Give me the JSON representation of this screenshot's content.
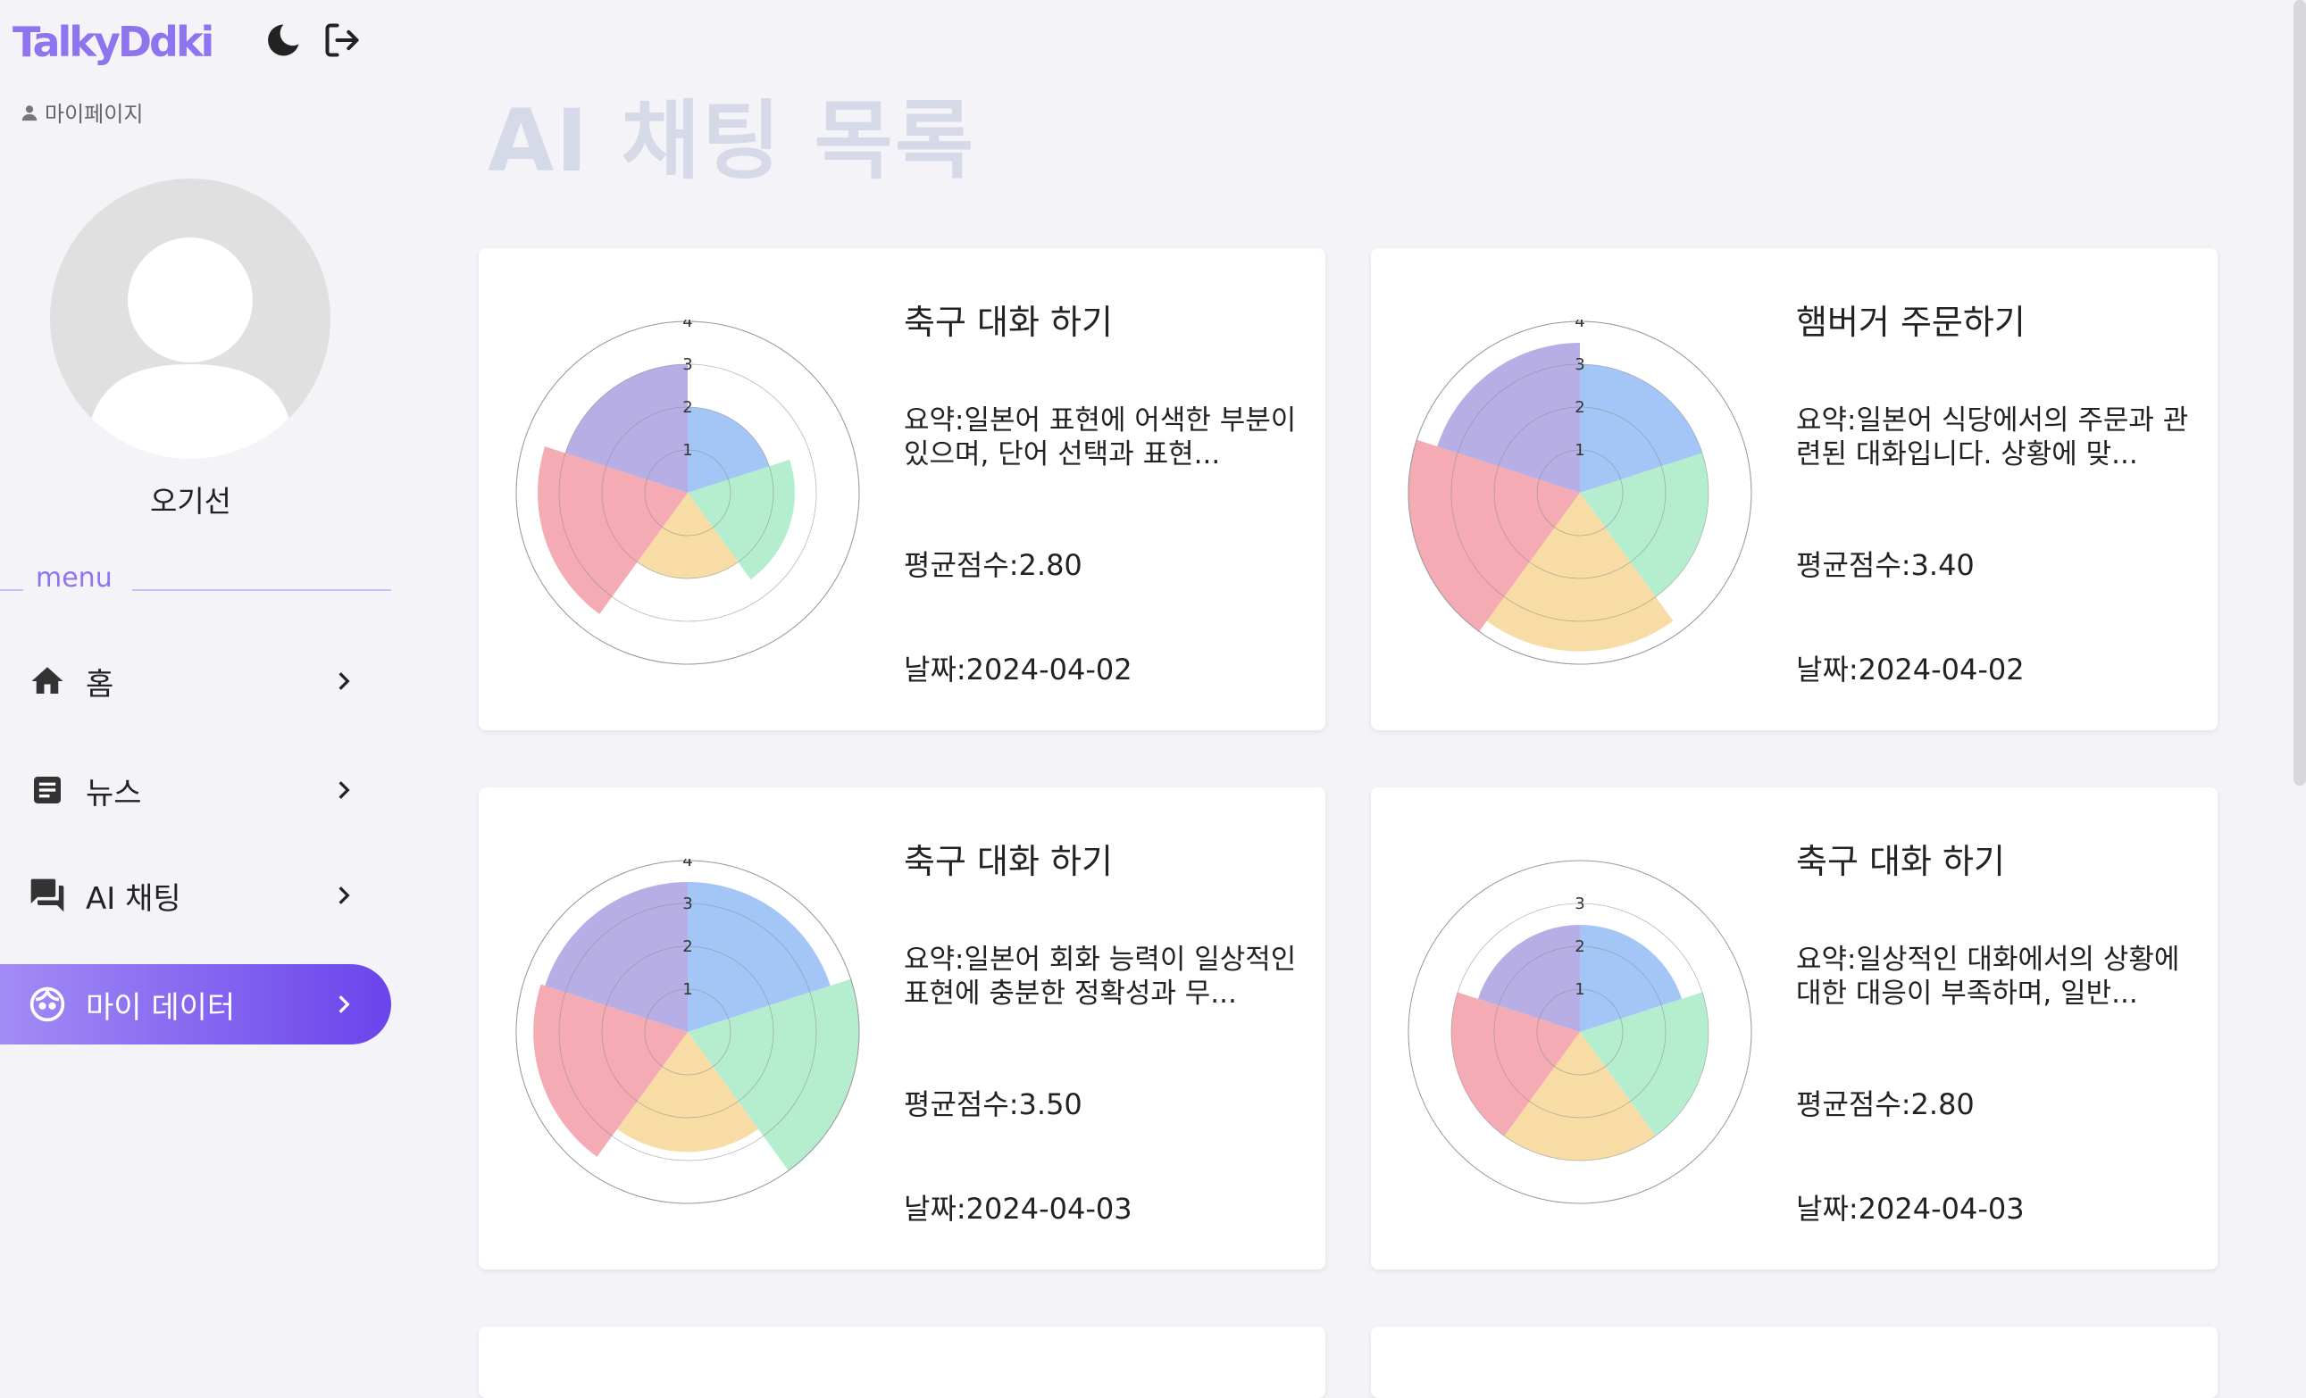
{
  "app": {
    "logo": "TalkyDdki",
    "mypage_link": "마이페이지",
    "username": "오기선",
    "menu_label": "menu",
    "icons": {
      "theme_toggle": "moon-icon",
      "logout": "logout-icon"
    }
  },
  "sidebar": {
    "items": [
      {
        "label": "홈",
        "icon": "home-icon",
        "active": false
      },
      {
        "label": "뉴스",
        "icon": "news-icon",
        "active": false
      },
      {
        "label": "AI 채팅",
        "icon": "chat-icon",
        "active": false
      },
      {
        "label": "마이 데이터",
        "icon": "face-icon",
        "active": true
      }
    ]
  },
  "main": {
    "title": "AI 채팅 목록",
    "cards": [
      {
        "title": "축구 대화 하기",
        "summary": "요약:일본어 표현에 어색한 부분이 있으며, 단어 선택과 표현...",
        "score": "평균점수:2.80",
        "date": "날짜:2024-04-02"
      },
      {
        "title": "햄버거 주문하기",
        "summary": "요약:일본어 식당에서의 주문과 관련된 대화입니다. 상황에 맞...",
        "score": "평균점수:3.40",
        "date": "날짜:2024-04-02"
      },
      {
        "title": "축구 대화 하기",
        "summary": "요약:일본어 회화 능력이 일상적인 표현에 충분한 정확성과 무...",
        "score": "평균점수:3.50",
        "date": "날짜:2024-04-03"
      },
      {
        "title": "축구 대화 하기",
        "summary": "요약:일상적인 대화에서의 상황에 대한 대응이 부족하며, 일반...",
        "score": "평균점수:2.80",
        "date": "날짜:2024-04-03"
      }
    ]
  },
  "chart_data": [
    {
      "type": "polar-area",
      "r_max": 4,
      "r_ticks": [
        "1",
        "2",
        "3",
        "4"
      ],
      "values": [
        2,
        2.5,
        2,
        3.5,
        3
      ],
      "colors": [
        "#a4c6f7",
        "#b5eecf",
        "#f8dca5",
        "#f4abb3",
        "#b8aee6"
      ]
    },
    {
      "type": "polar-area",
      "r_max": 4,
      "r_ticks": [
        "1",
        "2",
        "3",
        "4"
      ],
      "values": [
        3,
        3,
        3.7,
        4,
        3.5
      ],
      "colors": [
        "#a4c6f7",
        "#b5eecf",
        "#f8dca5",
        "#f4abb3",
        "#b8aee6"
      ]
    },
    {
      "type": "polar-area",
      "r_max": 4,
      "r_ticks": [
        "1",
        "2",
        "3",
        "4"
      ],
      "values": [
        3.5,
        4,
        2.8,
        3.6,
        3.5
      ],
      "colors": [
        "#a4c6f7",
        "#b5eecf",
        "#f8dca5",
        "#f4abb3",
        "#b8aee6"
      ]
    },
    {
      "type": "polar-area",
      "r_max": 3,
      "r_ticks": [
        "1",
        "2",
        "3"
      ],
      "values": [
        2.5,
        3,
        3,
        3,
        2.5
      ],
      "colors": [
        "#a4c6f7",
        "#b5eecf",
        "#f8dca5",
        "#f4abb3",
        "#b8aee6"
      ]
    }
  ]
}
